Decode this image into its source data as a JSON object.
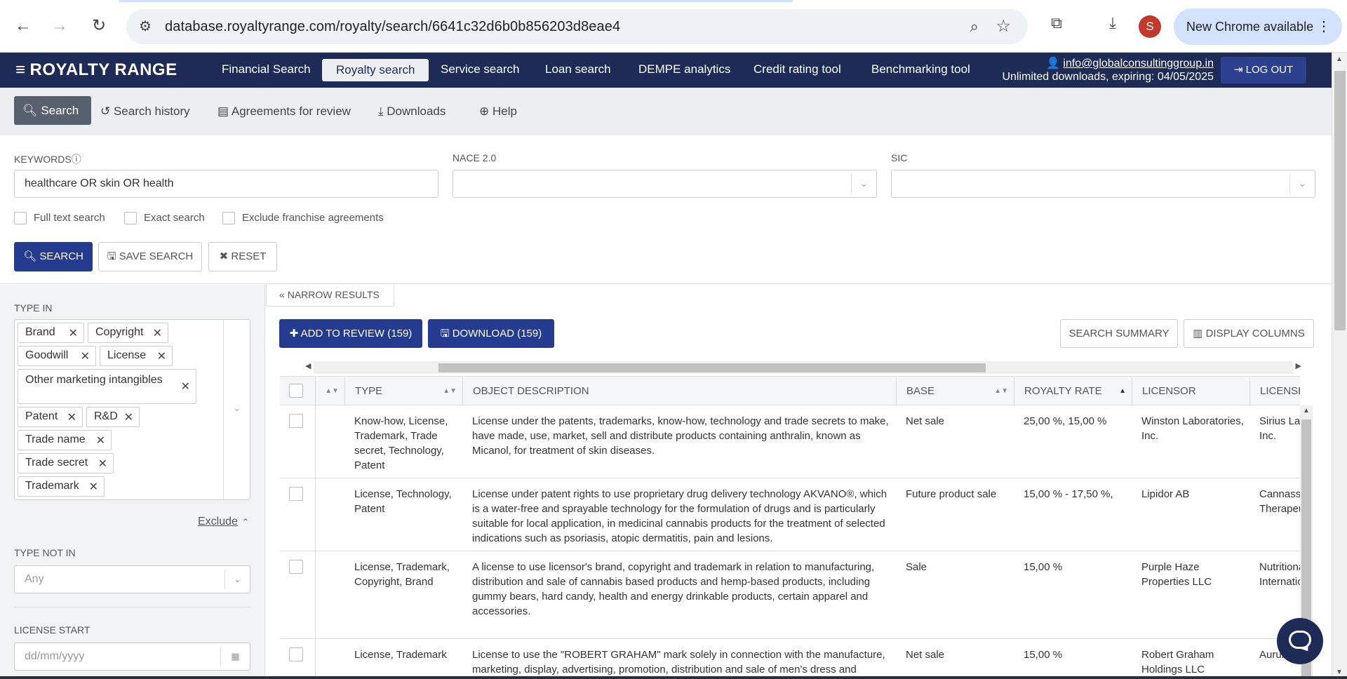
{
  "browser": {
    "url": "database.royaltyrange.com/royalty/search/6641c32d6b0b856203d8eae4",
    "profile_initial": "S",
    "new_chrome_label": "New Chrome available"
  },
  "app": {
    "logo": "ROYALTY RANGE",
    "nav": [
      "Financial Search",
      "Royalty search",
      "Service search",
      "Loan search",
      "DEMPE analytics",
      "Credit rating tool",
      "Benchmarking tool"
    ],
    "active_nav": "Royalty search",
    "user_email": "info@globalconsultinggroup.in",
    "subscription": "Unlimited downloads, expiring: 04/05/2025",
    "logout_label": "LOG OUT"
  },
  "subnav": {
    "search": "Search",
    "history": "Search history",
    "review": "Agreements for review",
    "downloads": "Downloads",
    "help": "Help"
  },
  "search_form": {
    "keywords_label": "KEYWORDS",
    "keywords_value": "healthcare OR skin OR health",
    "nace_label": "NACE 2.0",
    "sic_label": "SIC",
    "full_text": "Full text search",
    "exact": "Exact search",
    "exclude_franchise": "Exclude franchise agreements",
    "search_btn": "SEARCH",
    "save_btn": "SAVE SEARCH",
    "reset_btn": "RESET"
  },
  "filters": {
    "type_in_label": "TYPE IN",
    "tags": [
      "Brand",
      "Copyright",
      "Goodwill",
      "License",
      "Other marketing intangibles",
      "Patent",
      "R&D",
      "Trade name",
      "Trade secret",
      "Trademark"
    ],
    "exclude_link": "Exclude",
    "type_not_in_label": "TYPE NOT IN",
    "type_not_in_placeholder": "Any",
    "license_start_label": "LICENSE START",
    "license_start_placeholder": "dd/mm/yyyy"
  },
  "results": {
    "narrow_label": "NARROW RESULTS",
    "add_review_btn": "ADD TO REVIEW (159)",
    "download_btn": "DOWNLOAD (159)",
    "summary_btn": "SEARCH SUMMARY",
    "display_columns_btn": "DISPLAY COLUMNS",
    "columns": [
      "TYPE",
      "OBJECT DESCRIPTION",
      "BASE",
      "ROYALTY RATE",
      "LICENSOR",
      "LICENSE"
    ],
    "rows": [
      {
        "type": "Know-how, License, Trademark, Trade secret, Technology, Patent",
        "description": "License under the patents, trademarks, know-how, technology and trade secrets to make, have made, use, market, sell and distribute products containing anthralin, known as Micanol, for treatment of skin diseases.",
        "base": "Net sale",
        "rate": "25,00 %, 15,00 %",
        "licensor": "Winston Laboratories, Inc.",
        "licensee": "Sirius Laboratories, Inc."
      },
      {
        "type": "License, Technology, Patent",
        "description": "License under patent rights to use proprietary drug delivery technology AKVANO®, which is a water-free and sprayable technology for the formulation of drugs and is particularly suitable for local application, in medicinal cannabis products for the treatment of selected indications such as psoriasis, atopic dermatitis, pain and lesions.",
        "base": "Future product sale",
        "rate": "15,00 % - 17,50 %,",
        "licensor": "Lipidor AB",
        "licensee": "Cannassure Therapeutics"
      },
      {
        "type": "License, Trademark, Copyright, Brand",
        "description": "A license to use licensor's brand, copyright and trademark in relation to manufacturing, distribution and sale of cannabis based products and hemp-based products, including gummy bears, hard candy, health and energy drinkable products, certain apparel and accessories.",
        "base": "Sale",
        "rate": "15,00 %",
        "licensor": "Purple Haze Properties LLC",
        "licensee": "Nutritional International"
      },
      {
        "type": "License, Trademark",
        "description": "License to use the \"ROBERT GRAHAM\" mark solely in connection with the manufacture, marketing, display, advertising, promotion, distribution and sale of men's dress and",
        "base": "Net sale",
        "rate": "15,00 %",
        "licensor": "Robert Graham Holdings LLC",
        "licensee": "Aurum"
      }
    ]
  }
}
